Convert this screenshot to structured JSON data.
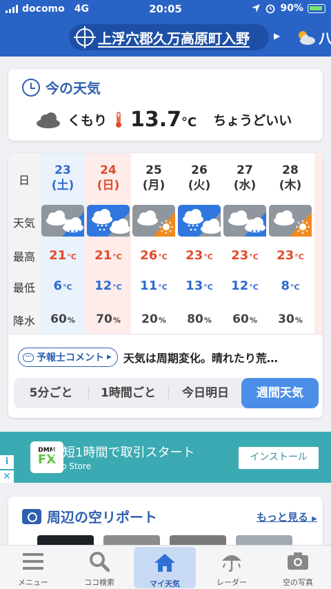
{
  "status_bar": {
    "carrier": "docomo",
    "network": "4G",
    "time": "20:05",
    "battery": "90%"
  },
  "header": {
    "location": "上浮穴郡久万高原町入野",
    "next_location_partial": "八"
  },
  "current": {
    "title": "今の天気",
    "condition": "くもり",
    "temperature": "13.7",
    "unit": "°C",
    "feel": "ちょうどいい"
  },
  "forecast": {
    "row_labels": {
      "day": "日",
      "weather": "天気",
      "high": "最高",
      "low": "最低",
      "precip": "降水"
    },
    "days": [
      {
        "date": "23",
        "weekday": "(土)",
        "kind": "saturday",
        "icon": "cloudy-then-rain-icon",
        "high": "21",
        "low": "6",
        "precip": "60"
      },
      {
        "date": "24",
        "weekday": "(日)",
        "kind": "sunday",
        "icon": "rain-then-cloudy-icon",
        "high": "21",
        "low": "12",
        "precip": "70"
      },
      {
        "date": "25",
        "weekday": "(月)",
        "kind": "weekday",
        "icon": "cloudy-then-sunny-icon",
        "high": "26",
        "low": "11",
        "precip": "20"
      },
      {
        "date": "26",
        "weekday": "(火)",
        "kind": "weekday",
        "icon": "rain-then-cloudy-icon",
        "high": "23",
        "low": "13",
        "precip": "80"
      },
      {
        "date": "27",
        "weekday": "(水)",
        "kind": "weekday",
        "icon": "cloudy-then-rain-icon",
        "high": "23",
        "low": "12",
        "precip": "60"
      },
      {
        "date": "28",
        "weekday": "(木)",
        "kind": "weekday",
        "icon": "cloudy-then-sunny-icon",
        "high": "23",
        "low": "8",
        "precip": "30"
      }
    ],
    "temp_unit": "°C",
    "precip_unit": "%",
    "comment_badge": "予報士コメント",
    "comment_text": "天気は周期変化。晴れたり荒…",
    "tabs": [
      "5分ごと",
      "1時間ごと",
      "今日明日",
      "週間天気"
    ],
    "active_tab": "週間天気"
  },
  "ad": {
    "logo_top": "DMM",
    "logo_bottom": "FX",
    "title": "最短1時間で取引スタート",
    "subtitle": "App Store",
    "install": "インストール",
    "info": "i",
    "close": "✕"
  },
  "report": {
    "title": "周辺の空リポート",
    "more": "もっと見る"
  },
  "bottom_nav": {
    "items": [
      {
        "label": "メニュー",
        "icon": "menu-icon"
      },
      {
        "label": "ココ検索",
        "icon": "search-icon"
      },
      {
        "label": "マイ天気",
        "icon": "home-icon"
      },
      {
        "label": "レーダー",
        "icon": "radar-umbrella-icon"
      },
      {
        "label": "空の写真",
        "icon": "camera-icon"
      }
    ],
    "active": "マイ天気"
  },
  "colors": {
    "header_blue": "#2a63c6",
    "high_red": "#e24a2a",
    "low_blue": "#2e6ad0",
    "active_tab": "#4a8ee8",
    "ad_teal": "#3caab3"
  }
}
